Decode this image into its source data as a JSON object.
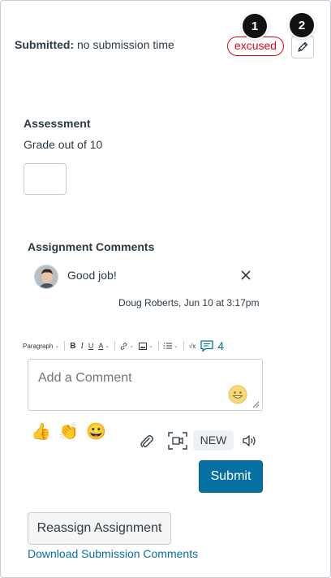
{
  "submission": {
    "label": "Submitted:",
    "value": "no submission time",
    "status_badge": "excused"
  },
  "callouts": {
    "first": "1",
    "second": "2"
  },
  "assessment": {
    "heading": "Assessment",
    "grade_label": "Grade out of 10",
    "grade_value": ""
  },
  "comments": {
    "heading": "Assignment Comments",
    "items": [
      {
        "text": "Good job!",
        "meta": "Doug Roberts, Jun 10 at 3:17pm"
      }
    ]
  },
  "editor_toolbar": {
    "paragraph_label": "Paragraph",
    "bold": "B",
    "italic": "I",
    "underline": "U",
    "text_color": "A",
    "math": "√x",
    "comment_count": "4"
  },
  "comment_input": {
    "placeholder": "Add a Comment"
  },
  "emoji_reactions": [
    "👍",
    "👏",
    "😀"
  ],
  "media": {
    "new_badge": "NEW"
  },
  "actions": {
    "submit_label": "Submit",
    "reassign_label": "Reassign Assignment",
    "download_link": "Download Submission Comments"
  },
  "colors": {
    "accent": "#0770a3",
    "excused": "#e0061f",
    "text": "#2d3b45",
    "border": "#c7cdd1"
  },
  "icons": [
    "pencil-icon",
    "avatar",
    "close-icon",
    "comment-icon",
    "emoji-face-icon",
    "paperclip-icon",
    "media-capture-icon",
    "speaker-icon",
    "resize-grip-icon"
  ]
}
